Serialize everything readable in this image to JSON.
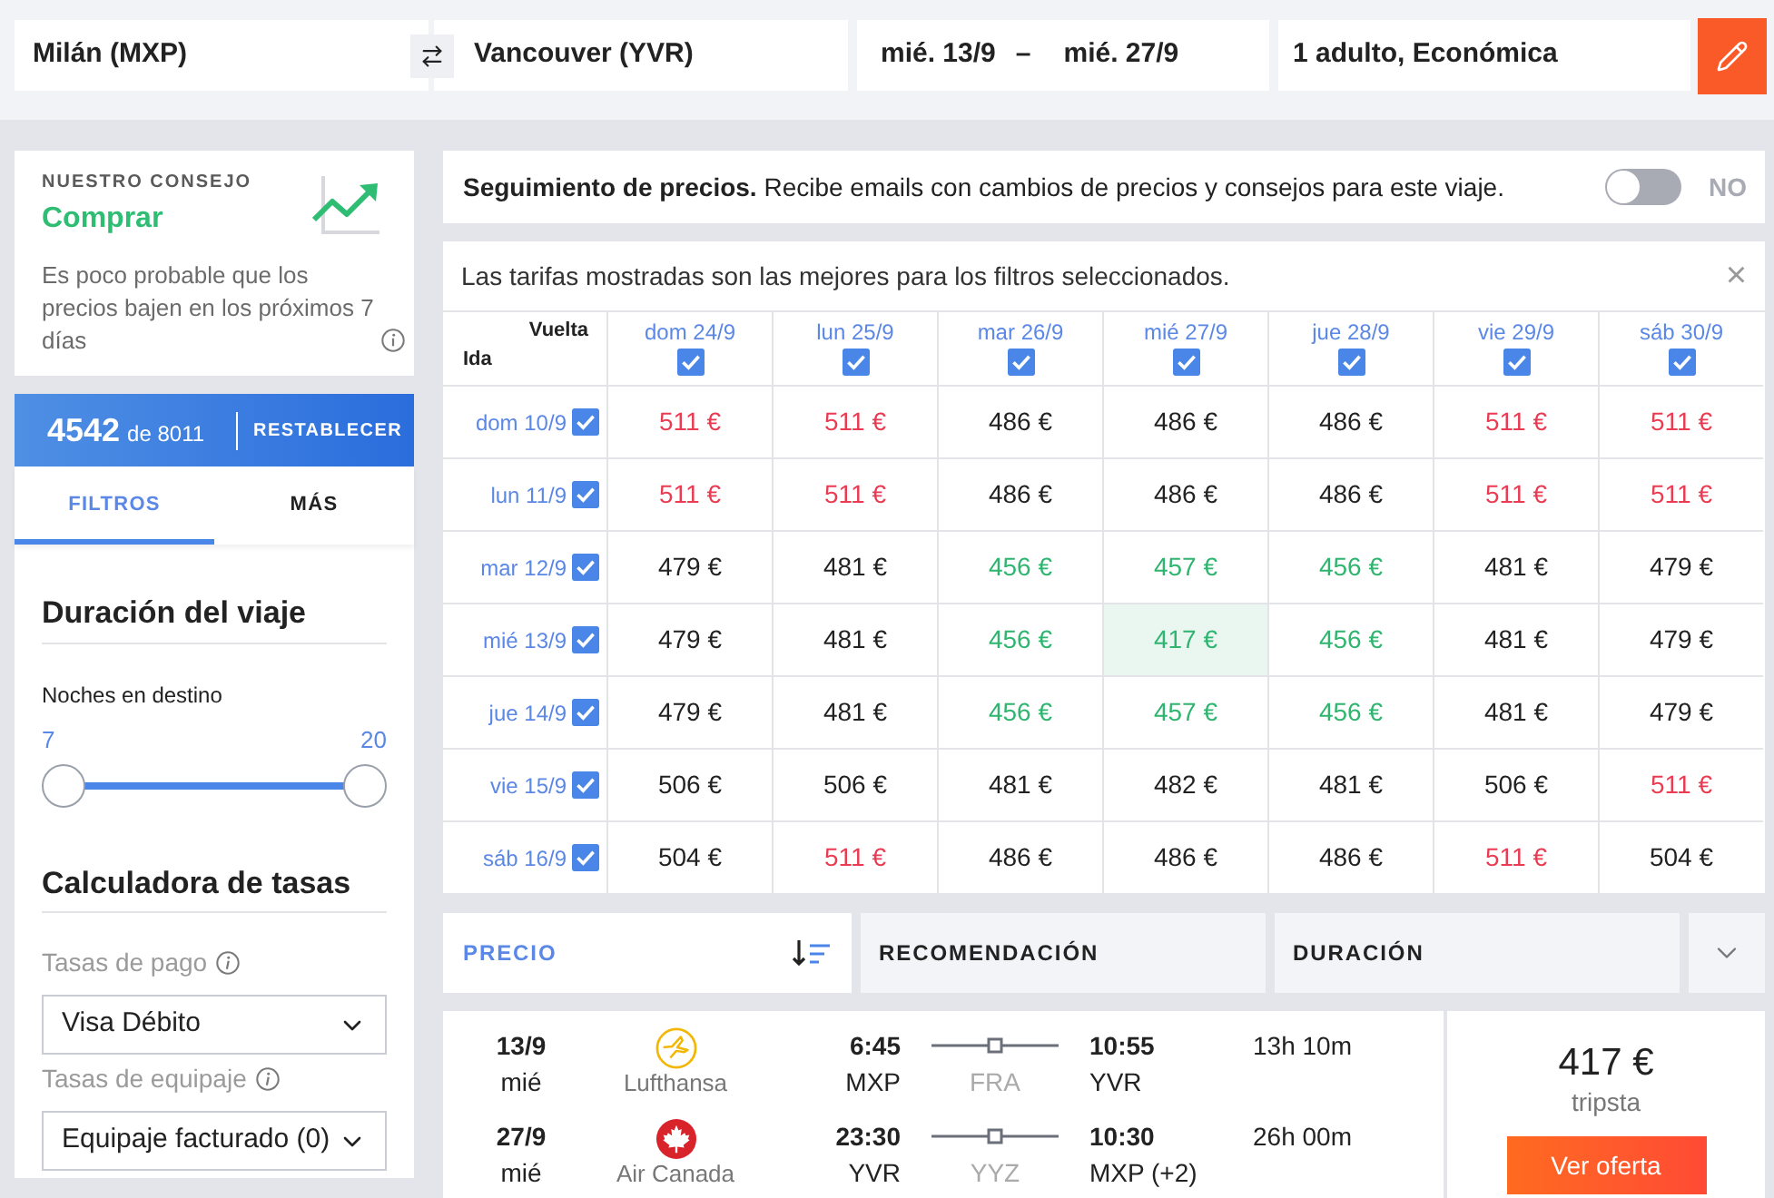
{
  "search": {
    "origin": "Milán (MXP)",
    "destination": "Vancouver (YVR)",
    "departure_date": "mié. 13/9",
    "date_separator": "–",
    "return_date": "mié. 27/9",
    "travellers": "1 adulto, Económica"
  },
  "advice": {
    "label": "NUESTRO CONSEJO",
    "verdict": "Comprar",
    "text": "Es poco probable que los precios bajen en los próximos 7 días"
  },
  "results": {
    "count": "4542",
    "total": "de 8011",
    "reset": "RESTABLECER"
  },
  "sidebar_tabs": [
    {
      "label": "FILTROS",
      "selected": true
    },
    {
      "label": "MÁS",
      "selected": false
    }
  ],
  "trip_duration": {
    "title": "Duración del viaje",
    "label": "Noches en destino",
    "min": "7",
    "max": "20",
    "thumbs": [
      {
        "level": 0
      },
      {
        "level": 1
      }
    ]
  },
  "fee_calculator": {
    "title": "Calculadora de tasas",
    "fields": [
      {
        "label": "Tasas de pago",
        "value": "Visa Débito"
      },
      {
        "label": "Tasas de equipaje",
        "value": "Equipaje facturado (0)"
      }
    ]
  },
  "price_tracking": {
    "text": "**Seguimiento de precios.** Recibe emails con cambios de precios y consejos para este viaje.",
    "on": false,
    "state": "NO"
  },
  "price_grid": {
    "notice": "Las tarifas mostradas son las mejores para los filtros seleccionados.",
    "close": "×",
    "return_label": "Vuelta",
    "departure_label": "Ida",
    "columns": [
      {
        "label": "dom 24/9",
        "checked": true
      },
      {
        "label": "lun 25/9",
        "checked": true
      },
      {
        "label": "mar 26/9",
        "checked": true
      },
      {
        "label": "mié 27/9",
        "checked": true
      },
      {
        "label": "jue 28/9",
        "checked": true
      },
      {
        "label": "vie 29/9",
        "checked": true
      },
      {
        "label": "sáb 30/9",
        "checked": true
      }
    ],
    "rows": [
      {
        "label": "dom 10/9",
        "checked": true,
        "cells": [
          {
            "price": "511 €",
            "color": "#eb3b52",
            "selected": false
          },
          {
            "price": "511 €",
            "color": "#eb3b52",
            "selected": false
          },
          {
            "price": "486 €",
            "color": "#222222",
            "selected": false
          },
          {
            "price": "486 €",
            "color": "#222222",
            "selected": false
          },
          {
            "price": "486 €",
            "color": "#222222",
            "selected": false
          },
          {
            "price": "511 €",
            "color": "#eb3b52",
            "selected": false
          },
          {
            "price": "511 €",
            "color": "#eb3b52",
            "selected": false
          }
        ]
      },
      {
        "label": "lun 11/9",
        "checked": true,
        "cells": [
          {
            "price": "511 €",
            "color": "#eb3b52",
            "selected": false
          },
          {
            "price": "511 €",
            "color": "#eb3b52",
            "selected": false
          },
          {
            "price": "486 €",
            "color": "#222222",
            "selected": false
          },
          {
            "price": "486 €",
            "color": "#222222",
            "selected": false
          },
          {
            "price": "486 €",
            "color": "#222222",
            "selected": false
          },
          {
            "price": "511 €",
            "color": "#eb3b52",
            "selected": false
          },
          {
            "price": "511 €",
            "color": "#eb3b52",
            "selected": false
          }
        ]
      },
      {
        "label": "mar 12/9",
        "checked": true,
        "cells": [
          {
            "price": "479 €",
            "color": "#222222",
            "selected": false
          },
          {
            "price": "481 €",
            "color": "#222222",
            "selected": false
          },
          {
            "price": "456 €",
            "color": "#2fb56f",
            "selected": false
          },
          {
            "price": "457 €",
            "color": "#2fb56f",
            "selected": false
          },
          {
            "price": "456 €",
            "color": "#2fb56f",
            "selected": false
          },
          {
            "price": "481 €",
            "color": "#222222",
            "selected": false
          },
          {
            "price": "479 €",
            "color": "#222222",
            "selected": false
          }
        ]
      },
      {
        "label": "mié 13/9",
        "checked": true,
        "cells": [
          {
            "price": "479 €",
            "color": "#222222",
            "selected": false
          },
          {
            "price": "481 €",
            "color": "#222222",
            "selected": false
          },
          {
            "price": "456 €",
            "color": "#2fb56f",
            "selected": false
          },
          {
            "price": "417 €",
            "color": "#2fb56f",
            "selected": true
          },
          {
            "price": "456 €",
            "color": "#2fb56f",
            "selected": false
          },
          {
            "price": "481 €",
            "color": "#222222",
            "selected": false
          },
          {
            "price": "479 €",
            "color": "#222222",
            "selected": false
          }
        ]
      },
      {
        "label": "jue 14/9",
        "checked": true,
        "cells": [
          {
            "price": "479 €",
            "color": "#222222",
            "selected": false
          },
          {
            "price": "481 €",
            "color": "#222222",
            "selected": false
          },
          {
            "price": "456 €",
            "color": "#2fb56f",
            "selected": false
          },
          {
            "price": "457 €",
            "color": "#2fb56f",
            "selected": false
          },
          {
            "price": "456 €",
            "color": "#2fb56f",
            "selected": false
          },
          {
            "price": "481 €",
            "color": "#222222",
            "selected": false
          },
          {
            "price": "479 €",
            "color": "#222222",
            "selected": false
          }
        ]
      },
      {
        "label": "vie 15/9",
        "checked": true,
        "cells": [
          {
            "price": "506 €",
            "color": "#222222",
            "selected": false
          },
          {
            "price": "506 €",
            "color": "#222222",
            "selected": false
          },
          {
            "price": "481 €",
            "color": "#222222",
            "selected": false
          },
          {
            "price": "482 €",
            "color": "#222222",
            "selected": false
          },
          {
            "price": "481 €",
            "color": "#222222",
            "selected": false
          },
          {
            "price": "506 €",
            "color": "#222222",
            "selected": false
          },
          {
            "price": "511 €",
            "color": "#eb3b52",
            "selected": false
          }
        ]
      },
      {
        "label": "sáb 16/9",
        "checked": true,
        "cells": [
          {
            "price": "504 €",
            "color": "#222222",
            "selected": false
          },
          {
            "price": "511 €",
            "color": "#eb3b52",
            "selected": false
          },
          {
            "price": "486 €",
            "color": "#222222",
            "selected": false
          },
          {
            "price": "486 €",
            "color": "#222222",
            "selected": false
          },
          {
            "price": "486 €",
            "color": "#222222",
            "selected": false
          },
          {
            "price": "511 €",
            "color": "#eb3b52",
            "selected": false
          },
          {
            "price": "504 €",
            "color": "#222222",
            "selected": false
          }
        ]
      }
    ]
  },
  "sort_tabs": [
    {
      "label": "PRECIO",
      "selected": true
    },
    {
      "label": "RECOMENDACIÓN",
      "selected": false
    },
    {
      "label": "DURACIÓN",
      "selected": false
    }
  ],
  "result": {
    "legs": [
      {
        "date": "13/9",
        "weekday": "mié",
        "airline": "Lufthansa",
        "departure_time": "6:45",
        "departure_airport": "MXP",
        "stop": "FRA",
        "arrival_time": "10:55",
        "arrival_airport": "YVR",
        "duration": "13h 10m"
      },
      {
        "date": "27/9",
        "weekday": "mié",
        "airline": "Air Canada",
        "departure_time": "23:30",
        "departure_airport": "YVR",
        "stop": "YYZ",
        "arrival_time": "10:30",
        "arrival_airport": "MXP (+2)",
        "duration": "26h 00m"
      }
    ],
    "price": "417 €",
    "provider": "tripsta",
    "cta": "Ver oferta"
  }
}
